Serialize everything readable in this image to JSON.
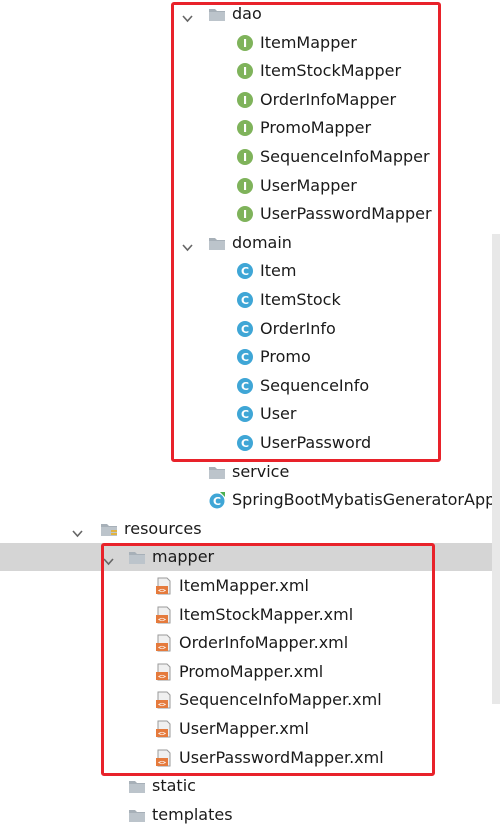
{
  "tree": {
    "dao": {
      "label": "dao",
      "items": [
        "ItemMapper",
        "ItemStockMapper",
        "OrderInfoMapper",
        "PromoMapper",
        "SequenceInfoMapper",
        "UserMapper",
        "UserPasswordMapper"
      ]
    },
    "domain": {
      "label": "domain",
      "items": [
        "Item",
        "ItemStock",
        "OrderInfo",
        "Promo",
        "SequenceInfo",
        "User",
        "UserPassword"
      ]
    },
    "service": {
      "label": "service"
    },
    "app_class": {
      "label": "SpringBootMybatisGeneratorApp"
    },
    "resources": {
      "label": "resources"
    },
    "mapper": {
      "label": "mapper",
      "items": [
        "ItemMapper.xml",
        "ItemStockMapper.xml",
        "OrderInfoMapper.xml",
        "PromoMapper.xml",
        "SequenceInfoMapper.xml",
        "UserMapper.xml",
        "UserPasswordMapper.xml"
      ]
    },
    "static": {
      "label": "static"
    },
    "templates": {
      "label": "templates"
    }
  },
  "icons": {
    "interface": "interface-icon",
    "class": "class-icon",
    "xml": "xml-file-icon",
    "folder": "folder-icon"
  },
  "colors": {
    "highlight_border": "#e8222a",
    "selected_row": "#d5d5d5",
    "interface_badge": "#7fb35b",
    "class_badge": "#3fa6d6",
    "folder": "#a7b0b8",
    "xml_badge": "#e57a3c"
  }
}
